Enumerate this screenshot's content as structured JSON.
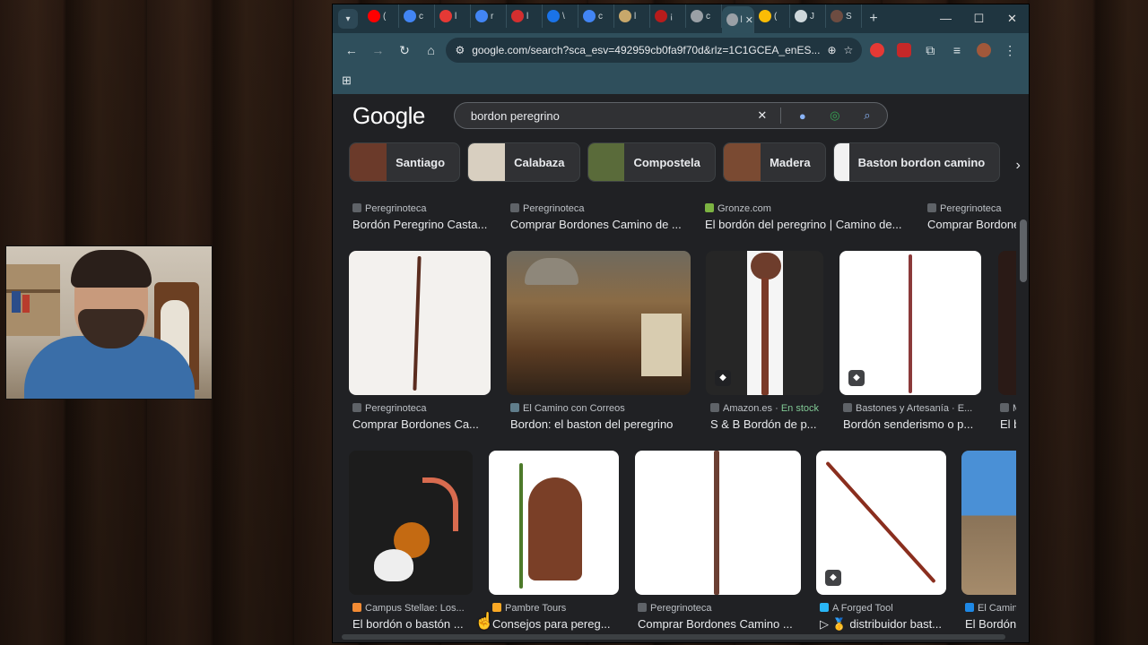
{
  "browser": {
    "tabs": [
      {
        "icon": "youtube-icon",
        "label": "(",
        "color": "#ff0000"
      },
      {
        "icon": "google-icon",
        "label": "c",
        "color": "#4285f4"
      },
      {
        "icon": "star-icon",
        "label": "l",
        "color": "#e53935"
      },
      {
        "icon": "google-icon",
        "label": "r",
        "color": "#4285f4"
      },
      {
        "icon": "flag-icon",
        "label": "l",
        "color": "#d32f2f"
      },
      {
        "icon": "reload-icon",
        "label": "\\",
        "color": "#1a73e8"
      },
      {
        "icon": "google-icon",
        "label": "c",
        "color": "#4285f4"
      },
      {
        "icon": "page-icon",
        "label": "l",
        "color": "#c8a86b"
      },
      {
        "icon": "bookmark-icon",
        "label": "¡",
        "color": "#b71c1c"
      },
      {
        "icon": "globe-icon",
        "label": "c",
        "color": "#9aa0a6"
      },
      {
        "icon": "tab-icon",
        "label": "l",
        "color": "#9aa0a6"
      },
      {
        "icon": "photos-icon",
        "label": "(",
        "color": "#fbbc05"
      },
      {
        "icon": "doc-icon",
        "label": "J",
        "color": "#cfd8dc"
      },
      {
        "icon": "tree-icon",
        "label": "S",
        "color": "#6d4c41"
      }
    ],
    "active_tab_index": 10,
    "new_tab_label": "+",
    "window_controls": {
      "minimize": "—",
      "maximize": "☐",
      "close": "✕"
    },
    "url": "google.com/search?sca_esv=492959cb0fa9f70d&rlz=1C1GCEA_enES...",
    "apps_icon": "apps-grid-icon"
  },
  "google": {
    "logo": "Google",
    "query": "bordon peregrino",
    "chips": [
      {
        "label": "Santiago",
        "thumb": "#6b3a2a"
      },
      {
        "label": "Calabaza",
        "thumb": "#d8cfc0"
      },
      {
        "label": "Compostela",
        "thumb": "#5a6b3a"
      },
      {
        "label": "Madera",
        "thumb": "#7a4a32"
      },
      {
        "label": "Baston bordon camino",
        "thumb": "#f2f2f2"
      }
    ],
    "results_row1_meta": [
      {
        "source": "Peregrinoteca",
        "title": "Bordón Peregrino Casta..."
      },
      {
        "source": "Peregrinoteca",
        "title": "Comprar Bordones Camino de ..."
      },
      {
        "source": "Gronze.com",
        "title": "El bordón del peregrino | Camino de..."
      },
      {
        "source": "Peregrinoteca",
        "title": "Comprar Bordone"
      }
    ],
    "results_row2": [
      {
        "source": "Peregrinoteca",
        "title": "Comprar Bordones Ca..."
      },
      {
        "source": "El Camino con Correos",
        "title": "Bordon: el baston del peregrino"
      },
      {
        "source": "Amazon.es",
        "stock": "En stock",
        "title": "S & B Bordón de p..."
      },
      {
        "source": "Bastones y Artesanía · E...",
        "title": "Bordón senderismo o p..."
      },
      {
        "source": "M",
        "title": "El b"
      }
    ],
    "results_row3": [
      {
        "source": "Campus Stellae: Los...",
        "title": "El bordón o bastón ..."
      },
      {
        "source": "Pambre Tours",
        "title": "Consejos para pereg..."
      },
      {
        "source": "Peregrinoteca",
        "title": "Comprar Bordones Camino ..."
      },
      {
        "source": "A Forged Tool",
        "title": "▷ 🥇 distribuidor bast..."
      },
      {
        "source": "El Camin",
        "title": "El Bordón,"
      }
    ]
  }
}
